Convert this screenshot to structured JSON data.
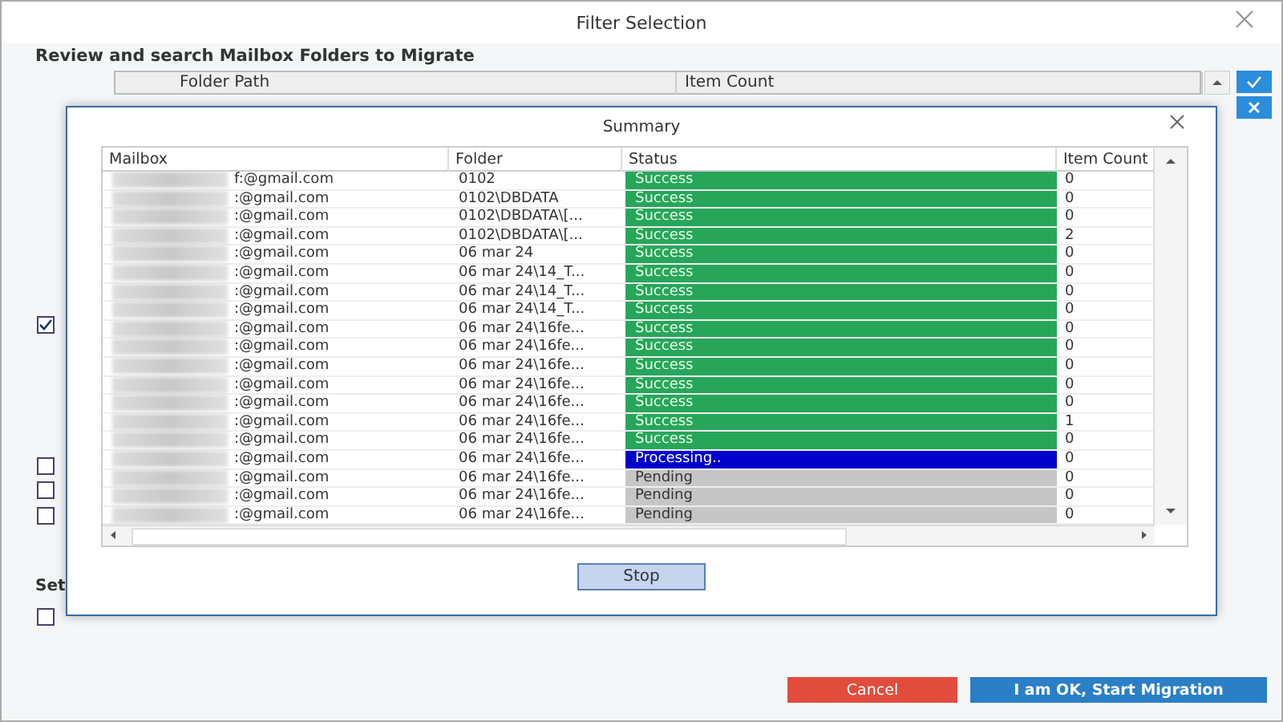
{
  "window": {
    "title": "Filter Selection"
  },
  "heading": "Review and search Mailbox Folders to Migrate",
  "folder_table": {
    "columns": [
      "Folder Path",
      "Item Count"
    ]
  },
  "background_checkboxes": [
    {
      "checked": true
    },
    {
      "checked": false
    },
    {
      "checked": false
    },
    {
      "checked": false
    }
  ],
  "settings_label": "Set",
  "skip_option": {
    "checked": false
  },
  "summary": {
    "title": "Summary",
    "columns": [
      "Mailbox",
      "Folder",
      "Status",
      "Item Count"
    ],
    "rows": [
      {
        "mailbox": "f:@gmail.com",
        "folder": "0102",
        "status": "Success",
        "kind": "success",
        "count": "0"
      },
      {
        "mailbox": ":@gmail.com",
        "folder": "0102\\DBDATA",
        "status": "Success",
        "kind": "success",
        "count": "0"
      },
      {
        "mailbox": ":@gmail.com",
        "folder": "0102\\DBDATA\\[...",
        "status": "Success",
        "kind": "success",
        "count": "0"
      },
      {
        "mailbox": ":@gmail.com",
        "folder": "0102\\DBDATA\\[...",
        "status": "Success",
        "kind": "success",
        "count": "2"
      },
      {
        "mailbox": ":@gmail.com",
        "folder": "06 mar 24",
        "status": "Success",
        "kind": "success",
        "count": "0"
      },
      {
        "mailbox": ":@gmail.com",
        "folder": "06 mar 24\\14_T...",
        "status": "Success",
        "kind": "success",
        "count": "0"
      },
      {
        "mailbox": ":@gmail.com",
        "folder": "06 mar 24\\14_T...",
        "status": "Success",
        "kind": "success",
        "count": "0"
      },
      {
        "mailbox": ":@gmail.com",
        "folder": "06 mar 24\\14_T...",
        "status": "Success",
        "kind": "success",
        "count": "0"
      },
      {
        "mailbox": ":@gmail.com",
        "folder": "06 mar 24\\16fe...",
        "status": "Success",
        "kind": "success",
        "count": "0"
      },
      {
        "mailbox": ":@gmail.com",
        "folder": "06 mar 24\\16fe...",
        "status": "Success",
        "kind": "success",
        "count": "0"
      },
      {
        "mailbox": ":@gmail.com",
        "folder": "06 mar 24\\16fe...",
        "status": "Success",
        "kind": "success",
        "count": "0"
      },
      {
        "mailbox": ":@gmail.com",
        "folder": "06 mar 24\\16fe...",
        "status": "Success",
        "kind": "success",
        "count": "0"
      },
      {
        "mailbox": ":@gmail.com",
        "folder": "06 mar 24\\16fe...",
        "status": "Success",
        "kind": "success",
        "count": "0"
      },
      {
        "mailbox": ":@gmail.com",
        "folder": "06 mar 24\\16fe...",
        "status": "Success",
        "kind": "success",
        "count": "1"
      },
      {
        "mailbox": ":@gmail.com",
        "folder": "06 mar 24\\16fe...",
        "status": "Success",
        "kind": "success",
        "count": "0"
      },
      {
        "mailbox": ":@gmail.com",
        "folder": "06 mar 24\\16fe...",
        "status": "Processing..",
        "kind": "processing",
        "count": "0"
      },
      {
        "mailbox": ":@gmail.com",
        "folder": "06 mar 24\\16fe...",
        "status": "Pending",
        "kind": "pending",
        "count": "0"
      },
      {
        "mailbox": ":@gmail.com",
        "folder": "06 mar 24\\16fe...",
        "status": "Pending",
        "kind": "pending",
        "count": "0"
      },
      {
        "mailbox": ":@gmail.com",
        "folder": "06 mar 24\\16fe...",
        "status": "Pending",
        "kind": "pending",
        "count": "0"
      }
    ],
    "stop_button": "Stop"
  },
  "buttons": [
    {
      "label": "Cancel",
      "kind": "cancel"
    },
    {
      "label": "I am OK, Start Migration",
      "kind": "primary"
    }
  ]
}
